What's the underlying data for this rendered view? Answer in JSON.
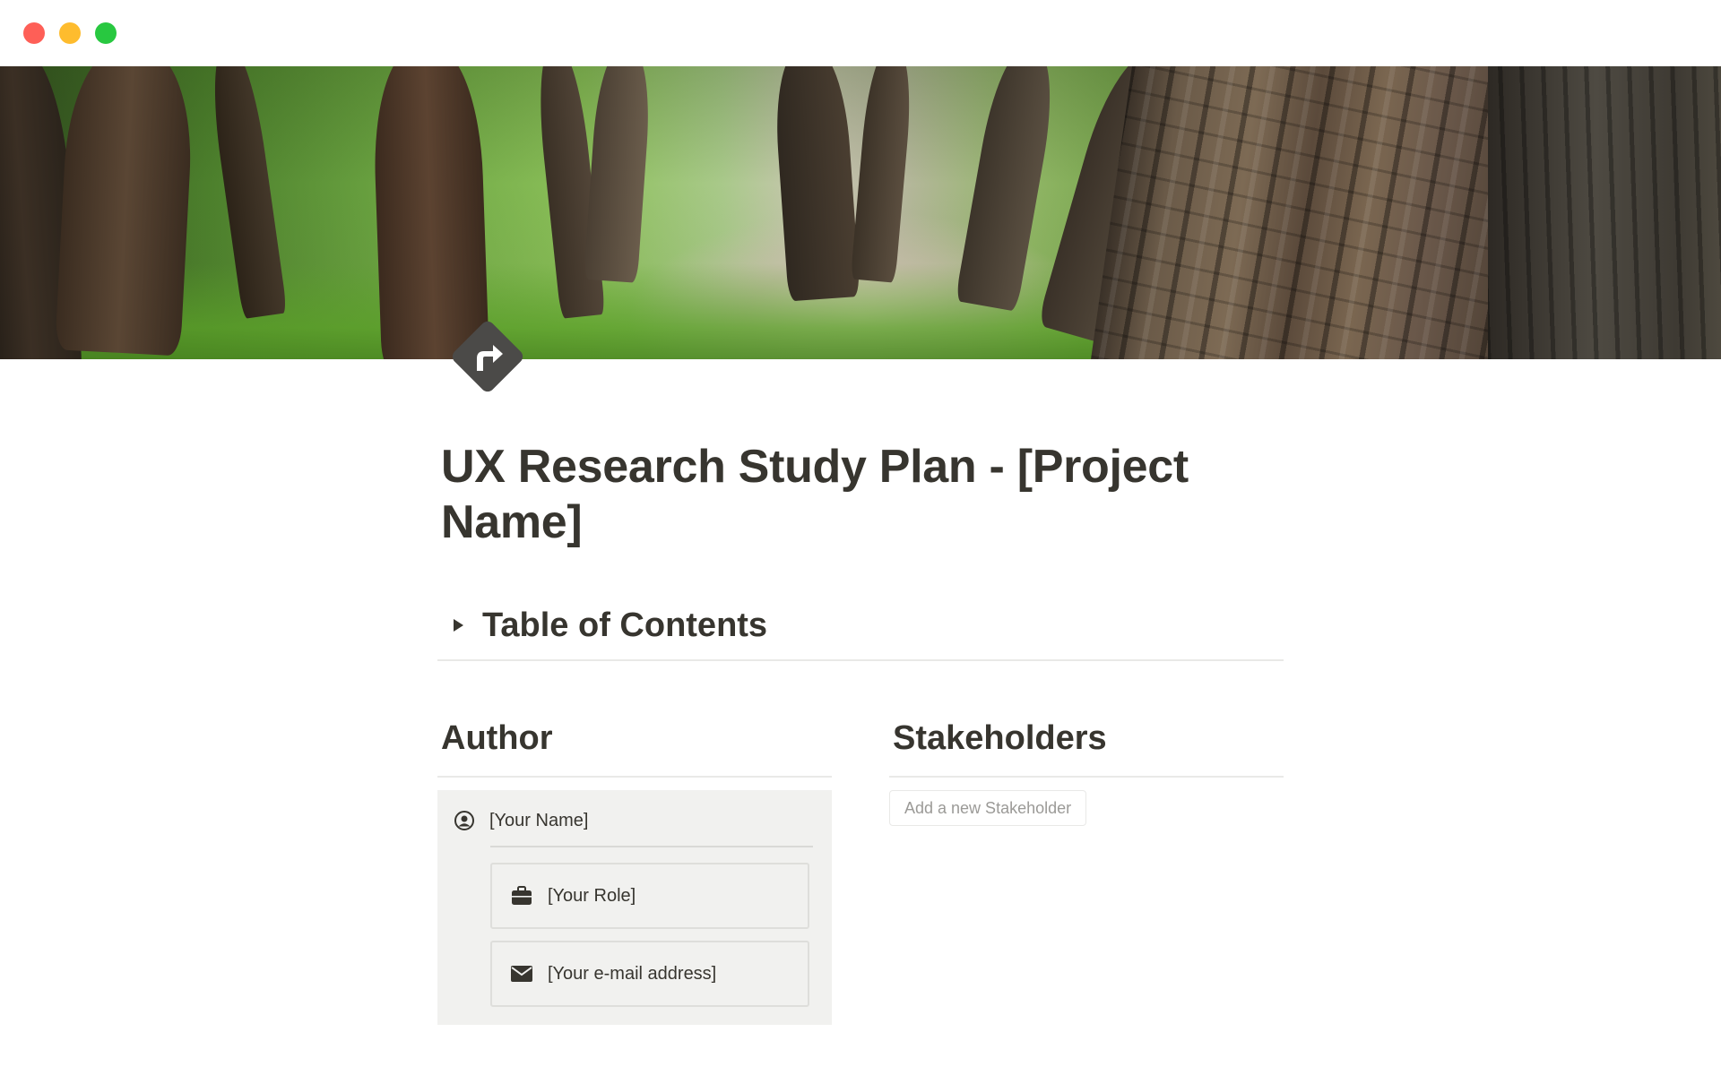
{
  "window": {
    "controls": [
      "close",
      "minimize",
      "maximize"
    ],
    "control_colors": {
      "close": "#fe5f57",
      "minimize": "#febc2e",
      "maximize": "#28c840"
    }
  },
  "cover": {
    "description_icon": "forest-path-cover-image"
  },
  "page": {
    "icon": "turn-right-sign-icon",
    "title": "UX Research Study Plan - [Project Name]"
  },
  "toc": {
    "title": "Table of Contents",
    "state": "collapsed"
  },
  "author": {
    "heading": "Author",
    "name": "[Your Name]",
    "role": "[Your Role]",
    "email": "[Your e-mail address]"
  },
  "stakeholders": {
    "heading": "Stakeholders",
    "add_button_label": "Add a new Stakeholder"
  },
  "colors": {
    "text": "#37352f",
    "muted": "#9b9a97",
    "card_bg": "#f1f1ef",
    "divider": "#e9e9e7"
  }
}
